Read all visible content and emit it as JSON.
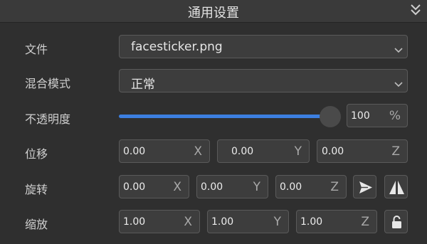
{
  "header": {
    "title": "通用设置",
    "collapse_icon": "double-chevron-down-icon"
  },
  "file": {
    "label": "文件",
    "value": "facesticker.png"
  },
  "blend_mode": {
    "label": "混合模式",
    "value": "正常"
  },
  "opacity": {
    "label": "不透明度",
    "value": "100",
    "unit": "%",
    "level": 1.0
  },
  "position": {
    "label": "位移",
    "x": {
      "value": "0.00",
      "axis": "X"
    },
    "y": {
      "value": "0.00",
      "axis": "Y"
    },
    "z": {
      "value": "0.00",
      "axis": "Z"
    }
  },
  "rotation": {
    "label": "旋转",
    "x": {
      "value": "0.00",
      "axis": "X"
    },
    "y": {
      "value": "0.00",
      "axis": "Y"
    },
    "z": {
      "value": "0.00",
      "axis": "Z"
    },
    "icons": [
      "send-icon",
      "flip-horizontal-icon"
    ]
  },
  "scale": {
    "label": "缩放",
    "x": {
      "value": "1.00",
      "axis": "X"
    },
    "y": {
      "value": "1.00",
      "axis": "Y"
    },
    "z": {
      "value": "1.00",
      "axis": "Z"
    },
    "icons": [
      "lock-icon"
    ]
  },
  "colors": {
    "accent": "#3c7fe0",
    "background": "#2f2f2f",
    "field": "#3d3d3d"
  }
}
